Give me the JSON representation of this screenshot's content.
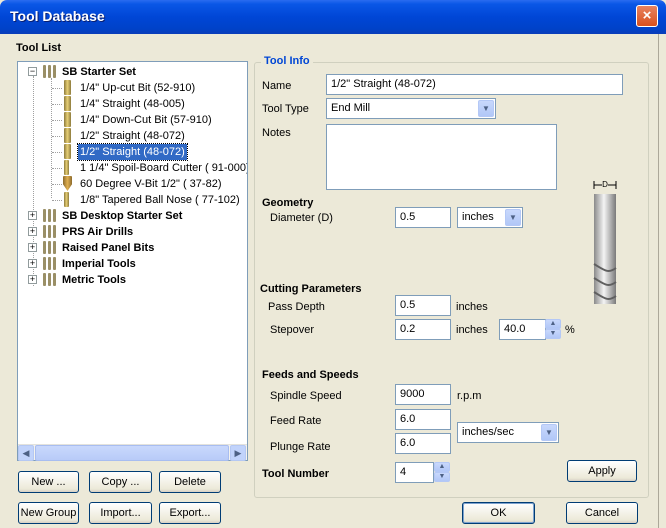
{
  "window": {
    "title": "Tool Database",
    "close_glyph": "×"
  },
  "tool_list": {
    "label": "Tool List",
    "groups": [
      {
        "label": "SB Starter Set",
        "expanded": true,
        "expander": "−",
        "items": [
          {
            "label": "1/4\" Up-cut Bit (52-910)",
            "icon": "end-mill-bit-icon"
          },
          {
            "label": "1/4\" Straight  (48-005)",
            "icon": "end-mill-bit-icon"
          },
          {
            "label": "1/4\"  Down-Cut Bit (57-910)",
            "icon": "end-mill-bit-icon"
          },
          {
            "label": "1/2\" Straight  (48-072)",
            "icon": "end-mill-bit-icon"
          },
          {
            "label": "1/2\" Straight  (48-072)",
            "icon": "end-mill-bit-icon",
            "selected": true
          },
          {
            "label": "1 1/4\" Spoil-Board Cutter ( 91-000)",
            "icon": "end-mill-bit-icon"
          },
          {
            "label": "60 Degree V-Bit 1/2\"  ( 37-82)",
            "icon": "v-bit-icon"
          },
          {
            "label": "1/8\" Tapered Ball Nose ( 77-102)",
            "icon": "ball-nose-bit-icon"
          }
        ]
      },
      {
        "label": "SB Desktop Starter Set",
        "expanded": false,
        "expander": "+"
      },
      {
        "label": "PRS Air Drills",
        "expanded": false,
        "expander": "+"
      },
      {
        "label": "Raised Panel Bits",
        "expanded": false,
        "expander": "+"
      },
      {
        "label": "Imperial Tools",
        "expanded": false,
        "expander": "+"
      },
      {
        "label": "Metric Tools",
        "expanded": false,
        "expander": "+"
      }
    ],
    "scroll_left": "◀",
    "scroll_right": "▶"
  },
  "list_buttons": {
    "new": "New ...",
    "copy": "Copy ...",
    "delete": "Delete",
    "new_group": "New Group",
    "import": "Import...",
    "export": "Export..."
  },
  "tool_info": {
    "title": "Tool Info",
    "name_label": "Name",
    "name_value": "1/2\" Straight  (48-072)",
    "tool_type_label": "Tool Type",
    "tool_type_value": "End Mill",
    "notes_label": "Notes",
    "notes_value": ""
  },
  "geometry": {
    "title": "Geometry",
    "diameter_label": "Diameter (D)",
    "diameter_value": "0.5",
    "units_value": "inches",
    "diagram_label": "D"
  },
  "cutting": {
    "title": "Cutting Parameters",
    "pass_depth_label": "Pass Depth",
    "pass_depth_value": "0.5",
    "pass_depth_unit": "inches",
    "stepover_label": "Stepover",
    "stepover_value": "0.2",
    "stepover_unit": "inches",
    "stepover_percent": "40.0",
    "percent_sign": "%"
  },
  "feeds": {
    "title": "Feeds and Speeds",
    "spindle_label": "Spindle Speed",
    "spindle_value": "9000",
    "spindle_unit": "r.p.m",
    "feed_label": "Feed Rate",
    "feed_value": "6.0",
    "plunge_label": "Plunge Rate",
    "plunge_value": "6.0",
    "rate_units_value": "inches/sec"
  },
  "tool_number": {
    "label": "Tool Number",
    "value": "4"
  },
  "actions": {
    "apply": "Apply",
    "ok": "OK",
    "cancel": "Cancel"
  },
  "glyphs": {
    "dropdown": "▼",
    "spin_up": "▲",
    "spin_down": "▼"
  },
  "colors": {
    "titlebar": "#0046d6",
    "selection": "#316ac5",
    "group_title": "#0046d5",
    "window_bg": "#ece9d8"
  }
}
